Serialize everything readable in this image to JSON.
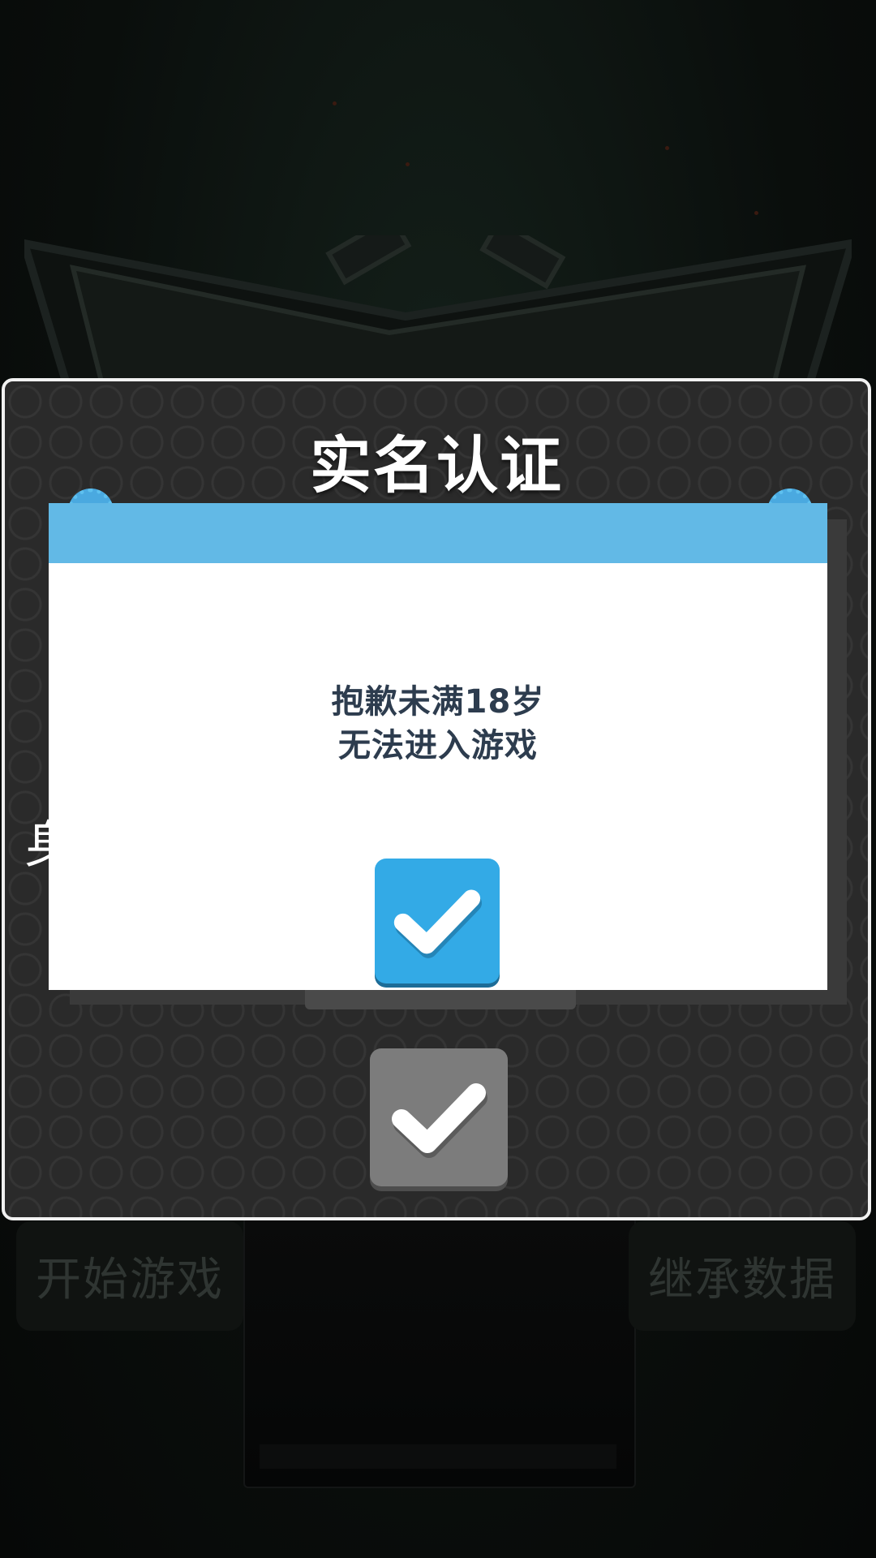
{
  "background": {
    "start_button_label": "开始游戏",
    "inherit_button_label": "继承数据"
  },
  "panel": {
    "title": "实名认证",
    "id_label_fragment": "身"
  },
  "dialog": {
    "message_line1": "抱歉未满18岁",
    "message_line2": "无法进入游戏"
  },
  "colors": {
    "dialog_header": "#62b9e6",
    "dialog_ok": "#33aae6",
    "panel_confirm": "#7c7c7c"
  },
  "icons": {
    "dialog_ok": "check-icon",
    "panel_confirm": "check-icon"
  }
}
